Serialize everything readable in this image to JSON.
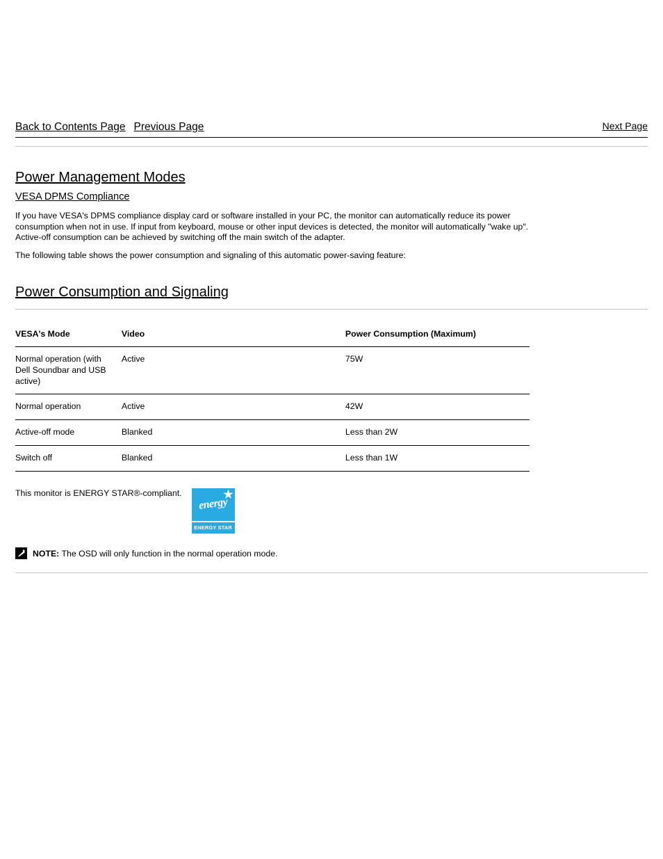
{
  "nav": {
    "back_label": "Back to Contents Page",
    "prev_label": "Previous Page",
    "next_label": "Next Page"
  },
  "power": {
    "title": "Power Management Modes",
    "subtitle": "VESA DPMS Compliance",
    "p1": "If you have VESA's DPMS compliance display card or software installed in your PC, the monitor can automatically reduce its power consumption when not in use. If input from keyboard, mouse or other input devices is detected, the monitor will automatically \"wake up\". Active-off consumption can be achieved by switching off the main switch of the adapter.",
    "p2": "The following table shows the power consumption and signaling of this automatic power-saving feature:"
  },
  "table": {
    "title": "Power Consumption and Signaling",
    "headers": [
      "VESA's Mode",
      "Video",
      "Power Consumption (Maximum)"
    ],
    "rows": [
      [
        "Normal operation (with Dell Soundbar and USB active)",
        "Active",
        "75W"
      ],
      [
        "Normal operation",
        "Active",
        "42W"
      ],
      [
        "Active-off mode",
        "Blanked",
        "Less than 2W"
      ],
      [
        "Switch off",
        "Blanked",
        "Less than 1W"
      ]
    ]
  },
  "energy": {
    "text": "This monitor is ENERGY STAR®-compliant.",
    "logo_script": "energy",
    "logo_caption": "ENERGY STAR"
  },
  "note": {
    "label": "NOTE:",
    "text": "The OSD will only function in the normal operation mode."
  }
}
